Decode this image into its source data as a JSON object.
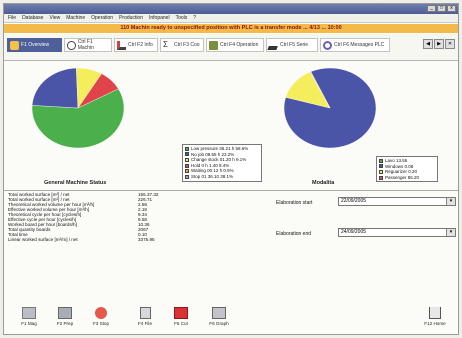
{
  "window": {
    "title": "",
    "buttons": [
      "_",
      "□",
      "x"
    ]
  },
  "menu": [
    "File",
    "Database",
    "View",
    "Machine",
    "Operation",
    "Production",
    "Infopanel",
    "Tools",
    "?"
  ],
  "banner": "110 Machin ready to unspecified position with PLC is a transfer mode ... 4/13 ... 10:00",
  "tabs": [
    {
      "label": "F1 Overview",
      "icon": "overview-icon",
      "active": true
    },
    {
      "label": "Ctrl F1 Machin",
      "icon": "circle-icon",
      "active": false
    },
    {
      "label": "Ctrl F2 Info",
      "icon": "tool-icon",
      "active": false
    },
    {
      "label": "Ctrl F3 Coo",
      "icon": "sigma-icon",
      "active": false
    },
    {
      "label": "Ctrl F4 Operation",
      "icon": "gear-icon",
      "active": false
    },
    {
      "label": "Ctrl F5 Serie",
      "icon": "pen-icon",
      "active": false
    },
    {
      "label": "Ctrl F6 Messages PLC",
      "icon": "message-icon",
      "active": false
    }
  ],
  "nav_buttons": [
    "◀",
    "▶",
    "✕"
  ],
  "colors": {
    "blue": "#4a55a8",
    "green": "#4bb04b",
    "yellow": "#f4ee5c",
    "red": "#e0434a",
    "pink": "#e84a6e"
  },
  "chart_data": [
    {
      "type": "pie",
      "title": "General Machine Status",
      "legend": [
        {
          "label": "Low pressure 36.21 h 58.6%",
          "color": "#4bb04b"
        },
        {
          "label": "No job 09.65 h 23.2%",
          "color": "#4a55a8"
        },
        {
          "label": "Change stock 01.20 h 9.1%",
          "color": "#f4ee5c"
        },
        {
          "label": "Hold 0 h 1.40 8.4%",
          "color": "#e0434a"
        },
        {
          "label": "Waiting 00.12 h 0.5%",
          "color": "#f0a040"
        },
        {
          "label": "Stop 01 36.10 38.1%",
          "color": "#9aa0d0"
        }
      ],
      "slices": [
        {
          "label": "Low pressure",
          "value": 58.6,
          "color": "#4bb04b"
        },
        {
          "label": "No job",
          "value": 23.2,
          "color": "#4a55a8"
        },
        {
          "label": "Change stock",
          "value": 9.1,
          "color": "#f4ee5c"
        },
        {
          "label": "Hold",
          "value": 8.4,
          "color": "#e0434a"
        }
      ]
    },
    {
      "type": "pie",
      "title": "Modalita",
      "legend": [
        {
          "label": "Lavo 13.55",
          "color": "#4bb04b"
        },
        {
          "label": "Windows 0.08",
          "color": "#4a55a8"
        },
        {
          "label": "Reguarizer 0.20",
          "color": "#f4ee5c"
        },
        {
          "label": "Passenger 86.20",
          "color": "#e84a6e"
        }
      ],
      "slices": [
        {
          "label": "Passenger",
          "value": 86.2,
          "color": "#4a55a8"
        },
        {
          "label": "Lavo",
          "value": 13.55,
          "color": "#f4ee5c"
        },
        {
          "label": "Windows",
          "value": 0.08,
          "color": "#e84a6e"
        },
        {
          "label": "Reguarizer",
          "value": 0.2,
          "color": "#e0434a"
        }
      ]
    }
  ],
  "stats": [
    {
      "label": "Total worked surface [m²] / net",
      "value": "155.37.32"
    },
    {
      "label": "Total worked surface [m²] / net",
      "value": "226.71"
    },
    {
      "label": "Theoretical worked volume per hour [m³/h]",
      "value": "2.58"
    },
    {
      "label": "Effective worked volume per hour [m³/h]",
      "value": "2.18"
    },
    {
      "label": "Theoretical cycle per hour [cycles/h]",
      "value": "9.34"
    },
    {
      "label": "Effective cycle per hour [cycles/h]",
      "value": "9.58"
    },
    {
      "label": "Worked board per hour [boards/h]",
      "value": "10.36"
    },
    {
      "label": "Total quantity boards",
      "value": "2067"
    },
    {
      "label": "Total time",
      "value": "0.10"
    },
    {
      "label": "Linear worked surface [m²/m] / net",
      "value": "3375.95"
    }
  ],
  "elaboration": {
    "start_label": "Elaboration start",
    "start_value": "22/09/2005",
    "end_label": "Elaboration end",
    "end_value": "24/09/2005"
  },
  "toolbar": [
    {
      "label": "F1 Mag",
      "icon": "magazine-icon",
      "color": "#9aa0a8"
    },
    {
      "label": "F2 Prep",
      "icon": "prepare-icon",
      "color": "#8a8f98"
    },
    {
      "label": "F3 Stop",
      "icon": "stop-icon",
      "color": "#e35a4a"
    },
    {
      "label": "F4 File",
      "icon": "file-icon",
      "color": "#8f9298"
    },
    {
      "label": "F5 Cut",
      "icon": "cut-icon",
      "color": "#d83232"
    },
    {
      "label": "F6 Graph",
      "icon": "graph-icon",
      "color": "#9a9ca4"
    },
    {
      "label": "F12 Home",
      "icon": "home-icon",
      "color": "#8a8c92"
    }
  ]
}
